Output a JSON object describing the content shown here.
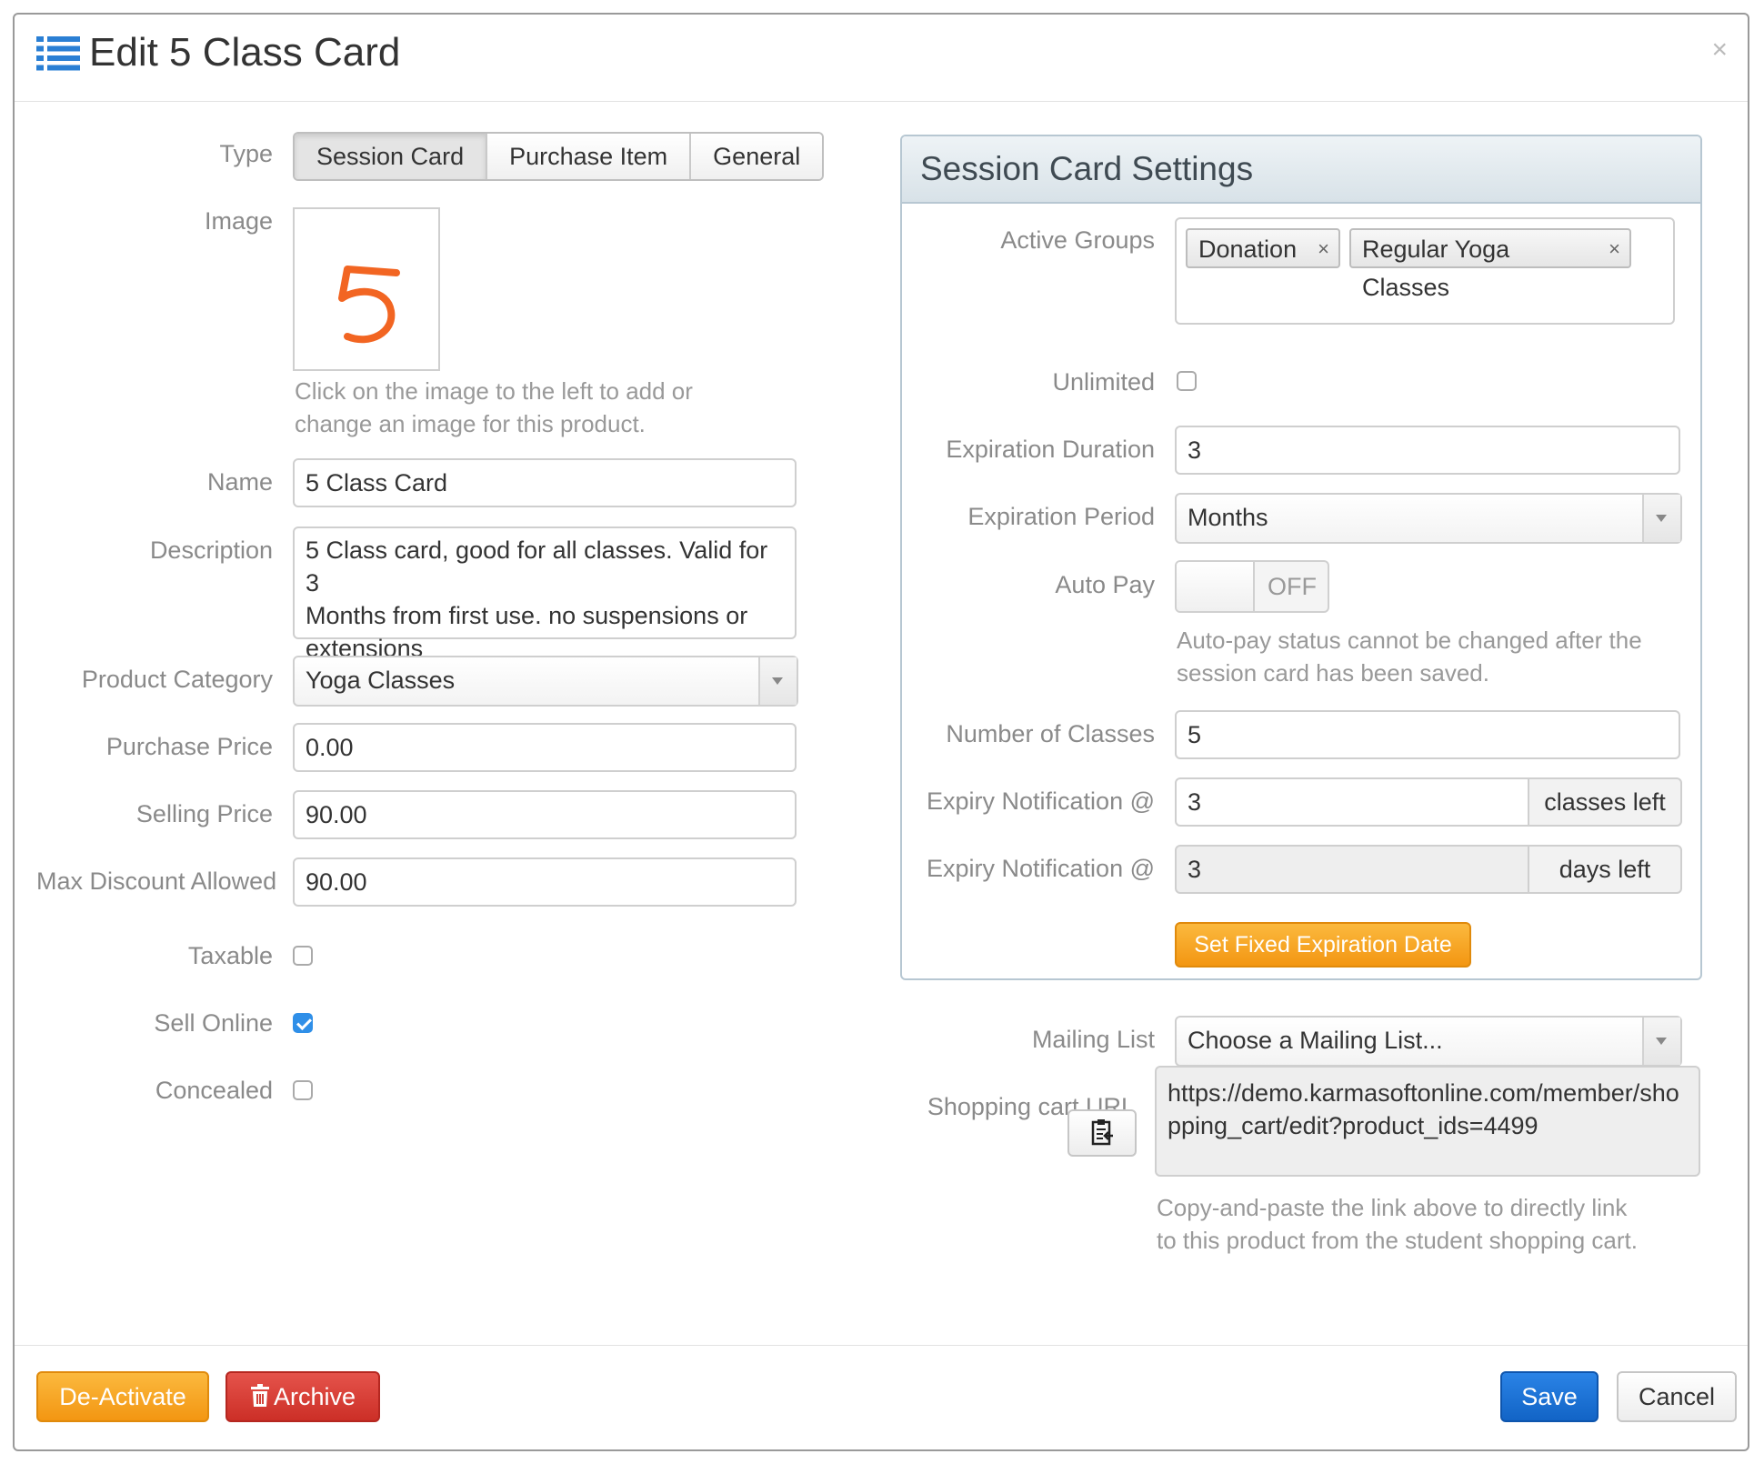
{
  "dialog": {
    "title": "Edit 5 Class Card",
    "close_symbol": "×",
    "title_icon": "list-icon"
  },
  "form": {
    "type": {
      "label": "Type",
      "options": [
        "Session Card",
        "Purchase Item",
        "General"
      ],
      "selected": "Session Card"
    },
    "image": {
      "label": "Image",
      "glyph": "5",
      "help_line1": "Click on the image to the left to add or",
      "help_line2": "change an image for this product."
    },
    "name": {
      "label": "Name",
      "value": "5 Class Card"
    },
    "description": {
      "label": "Description",
      "line1": "5 Class card, good for all classes. Valid for 3",
      "line2": "Months from first use. no suspensions or",
      "line3": "extensions"
    },
    "product_category": {
      "label": "Product Category",
      "value": "Yoga Classes"
    },
    "purchase_price": {
      "label": "Purchase Price",
      "value": "0.00"
    },
    "selling_price": {
      "label": "Selling Price",
      "value": "90.00"
    },
    "max_discount": {
      "label": "Max Discount Allowed",
      "value": "90.00"
    },
    "taxable": {
      "label": "Taxable",
      "checked": false
    },
    "sell_online": {
      "label": "Sell Online",
      "checked": true
    },
    "concealed": {
      "label": "Concealed",
      "checked": false
    }
  },
  "session_card_settings": {
    "title": "Session Card Settings",
    "active_groups": {
      "label": "Active Groups",
      "tags": [
        "Donation",
        "Regular Yoga Classes"
      ],
      "remove_symbol": "×"
    },
    "unlimited": {
      "label": "Unlimited",
      "checked": false
    },
    "expiration_duration": {
      "label": "Expiration Duration",
      "value": "3"
    },
    "expiration_period": {
      "label": "Expiration Period",
      "value": "Months"
    },
    "auto_pay": {
      "label": "Auto Pay",
      "state": "OFF",
      "help_line1": "Auto-pay status cannot be changed after the",
      "help_line2": "session card has been saved."
    },
    "number_of_classes": {
      "label": "Number of Classes",
      "value": "5"
    },
    "expiry_classes": {
      "label": "Expiry Notification @",
      "value": "3",
      "unit": "classes left"
    },
    "expiry_days": {
      "label": "Expiry Notification @",
      "value": "3",
      "unit": "days left"
    },
    "fixed_expiration_button": "Set Fixed Expiration Date"
  },
  "mailing_list": {
    "label": "Mailing List",
    "value": "Choose a Mailing List..."
  },
  "shopping_cart": {
    "label": "Shopping cart URL",
    "url": "https://demo.karmasoftonline.com/member/shopping_cart/edit?product_ids=4499",
    "help_line1": "Copy-and-paste the link above to directly link",
    "help_line2": "to this product from the student shopping cart."
  },
  "footer": {
    "deactivate": "De-Activate",
    "archive": "Archive",
    "save": "Save",
    "cancel": "Cancel"
  },
  "colors": {
    "orange": "#f39612",
    "red": "#cc2f27",
    "blue": "#1264c6",
    "check_blue": "#2f8fe8",
    "image_digit": "#f26522",
    "title_icon": "#2a7fd4"
  }
}
